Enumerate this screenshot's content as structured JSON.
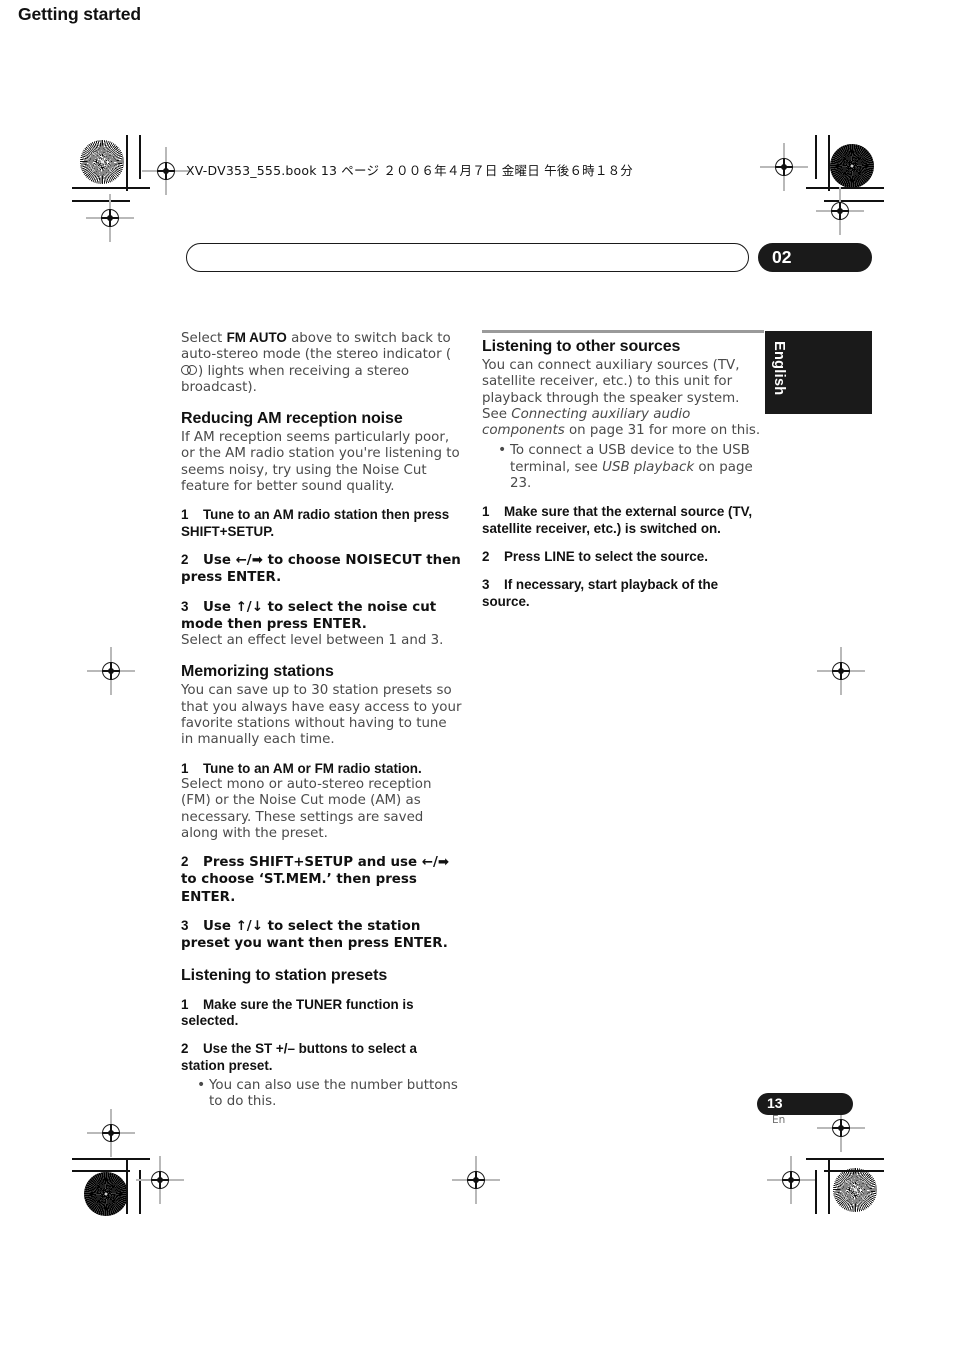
{
  "slug": {
    "text": "XV-DV353_555.book 13 ページ ２００６年４月７日 金曜日 午後６時１８分"
  },
  "running_head": {
    "title": "Getting started",
    "chapter_number": "02"
  },
  "language_tab": {
    "label": "English"
  },
  "folio": {
    "page_number": "13",
    "language_code": "En"
  },
  "left_column": {
    "intro": {
      "before": "Select ",
      "bold": "FM AUTO",
      "middle": " above to switch back to auto-stereo mode (the stereo indicator (",
      "glyph": "stereo-indicator-icon",
      "after": ") lights when receiving a stereo broadcast)."
    },
    "section_reducing_noise": {
      "heading": "Reducing AM reception noise",
      "intro": "If AM reception seems particularly poor, or the AM radio station you're listening to seems noisy, try using the Noise Cut feature for better sound quality.",
      "steps": [
        {
          "num": "1",
          "text": "Tune to an AM radio station then press SHIFT+SETUP."
        },
        {
          "num": "2",
          "text": "Use ←/➡ to choose NOISECUT then press ENTER."
        },
        {
          "num": "3",
          "text": "Use ↑/↓ to select the noise cut mode then press ENTER.",
          "note": "Select an effect level between 1 and 3."
        }
      ]
    },
    "section_memorizing": {
      "heading": "Memorizing stations",
      "intro": "You can save up to 30 station presets so that you always have easy access to your favorite stations without having to tune in manually each time.",
      "steps": [
        {
          "num": "1",
          "text": "Tune to an AM or FM radio station.",
          "note": "Select mono or auto-stereo reception (FM) or the Noise Cut mode (AM) as necessary. These settings are saved along with the preset."
        },
        {
          "num": "2",
          "text": "Press SHIFT+SETUP and use ←/➡ to choose ‘ST.MEM.’ then press ENTER."
        },
        {
          "num": "3",
          "text": "Use ↑/↓ to select the station preset you want then press ENTER."
        }
      ]
    },
    "section_presets": {
      "heading": "Listening to station presets",
      "steps": [
        {
          "num": "1",
          "text": "Make sure the TUNER function is selected."
        },
        {
          "num": "2",
          "text": "Use the ST +/– buttons to select a station preset."
        }
      ],
      "bullets": [
        "You can also use the number buttons to do this."
      ]
    }
  },
  "right_column": {
    "section_other_sources": {
      "heading": "Listening to other sources",
      "intro_part1": "You can connect auxiliary sources (TV, satellite receiver, etc.) to this unit for playback through the speaker system. See ",
      "intro_italic1": "Connecting auxiliary audio components",
      "intro_part2": " on page 31 for more on this.",
      "bullets": [
        {
          "part1": "To connect a USB device to the USB terminal, see ",
          "italic": "USB playback",
          "part2": " on page 23."
        }
      ],
      "steps": [
        {
          "num": "1",
          "text": "Make sure that the external source (TV, satellite receiver, etc.) is switched on."
        },
        {
          "num": "2",
          "text": "Press LINE to select the source."
        },
        {
          "num": "3",
          "text": "If necessary, start playback of the source."
        }
      ]
    }
  },
  "colors": {
    "ink_black": "#1a1a1a",
    "body_gray": "#4a4a4a",
    "rule_gray": "#9a9a9a"
  }
}
